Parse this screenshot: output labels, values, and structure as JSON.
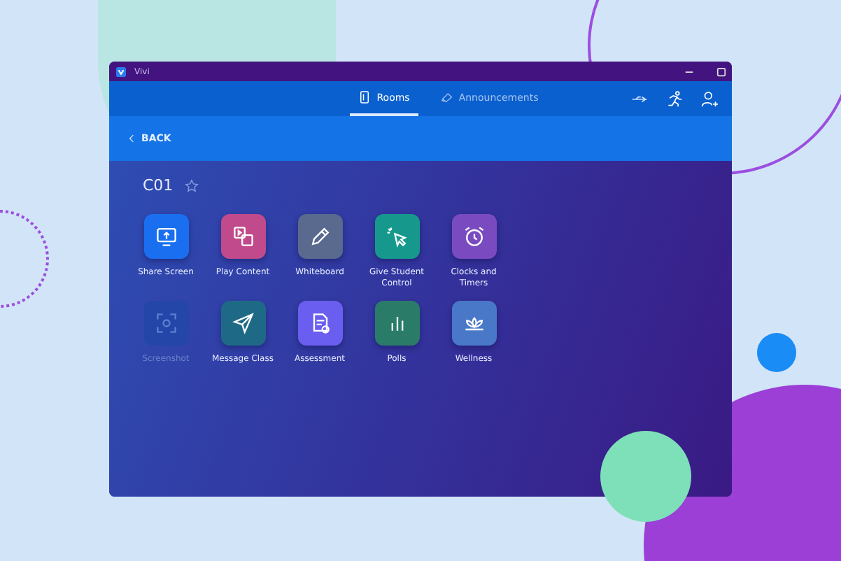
{
  "window": {
    "title": "Vivi"
  },
  "tabs": [
    {
      "label": "Rooms",
      "selected": true
    },
    {
      "label": "Announcements",
      "selected": false
    }
  ],
  "back": {
    "label": "BACK"
  },
  "room": {
    "name": "C01",
    "starred": false
  },
  "tiles": [
    {
      "label": "Share Screen",
      "color": "#1a6ff0",
      "disabled": false
    },
    {
      "label": "Play Content",
      "color": "#c04a8c",
      "disabled": false
    },
    {
      "label": "Whiteboard",
      "color": "#596a8e",
      "disabled": false
    },
    {
      "label": "Give Student Control",
      "color": "#16998c",
      "disabled": false
    },
    {
      "label": "Clocks and Timers",
      "color": "#7a4bc0",
      "disabled": false
    },
    {
      "label": "Screenshot",
      "color": "#2446a8",
      "disabled": true
    },
    {
      "label": "Message Class",
      "color": "#1e6a86",
      "disabled": false
    },
    {
      "label": "Assessment",
      "color": "#6a5ef0",
      "disabled": false
    },
    {
      "label": "Polls",
      "color": "#2a7c68",
      "disabled": false
    },
    {
      "label": "Wellness",
      "color": "#4a78c8",
      "disabled": false
    }
  ]
}
